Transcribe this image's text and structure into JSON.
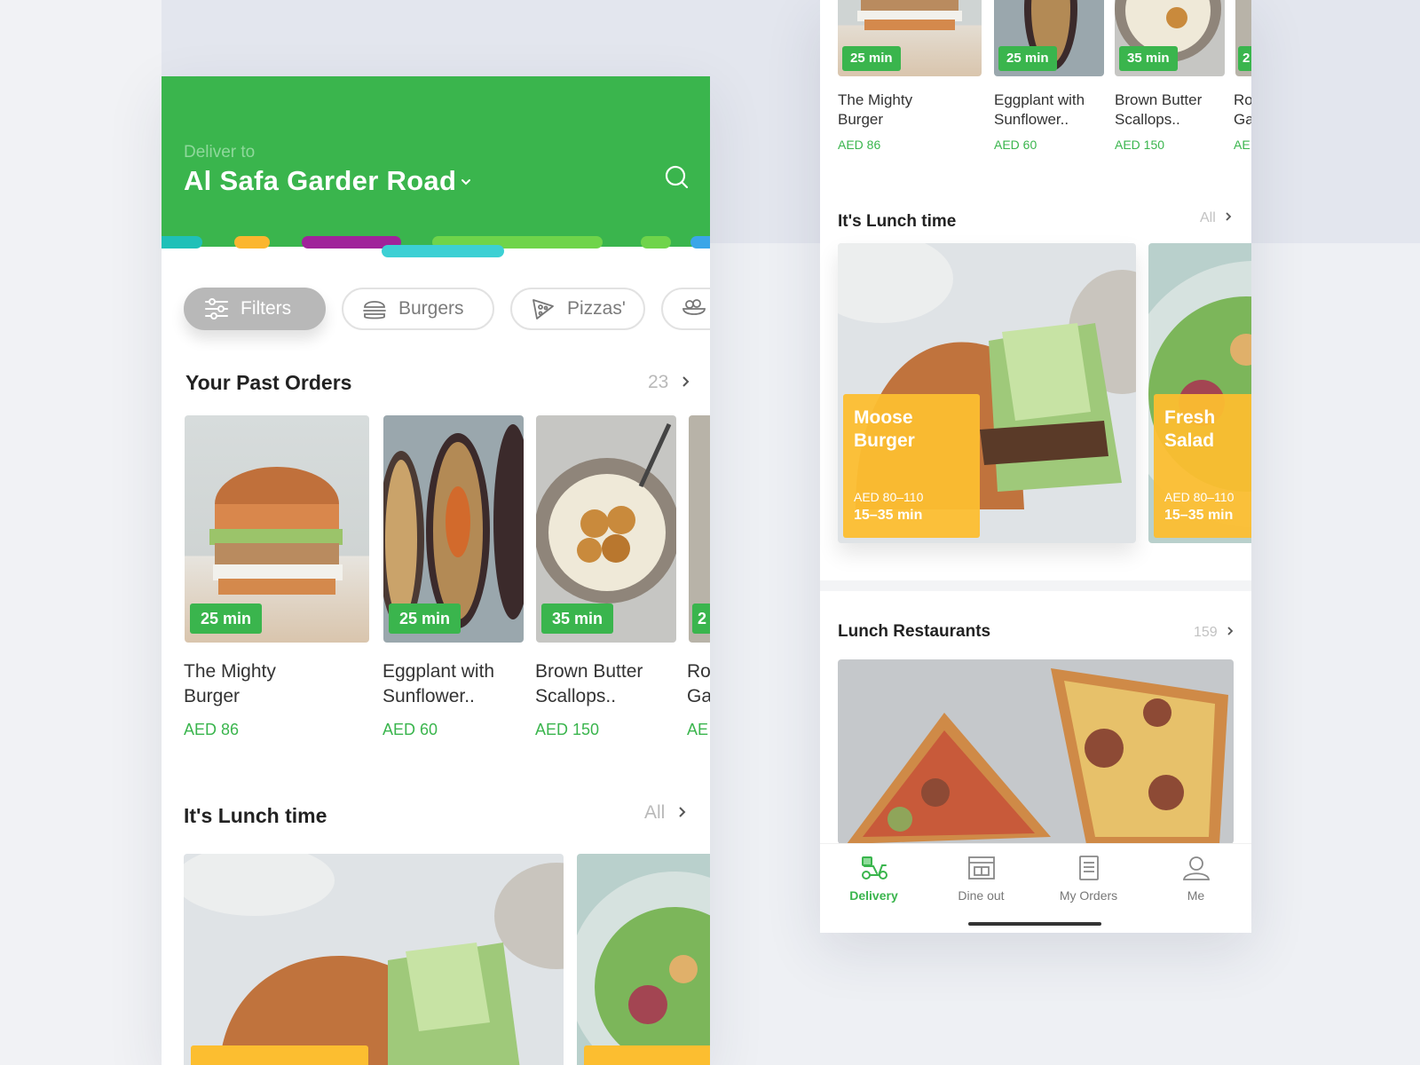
{
  "left": {
    "header": {
      "deliver_label": "Deliver to",
      "address": "Al Safa Garder Road"
    },
    "chips": [
      {
        "label": "Filters",
        "icon": "sliders-icon"
      },
      {
        "label": "Burgers",
        "icon": "burger-icon"
      },
      {
        "label": "Pizzas'",
        "icon": "pizza-icon"
      },
      {
        "label": "",
        "icon": "salad-bowl-icon"
      }
    ],
    "past_orders": {
      "title": "Your Past Orders",
      "count": "23",
      "items": [
        {
          "time": "25 min",
          "name_line1": "The Mighty",
          "name_line2": "Burger",
          "price": "AED 86"
        },
        {
          "time": "25 min",
          "name_line1": "Eggplant with",
          "name_line2": "Sunflower..",
          "price": "AED 60"
        },
        {
          "time": "35 min",
          "name_line1": "Brown Butter",
          "name_line2": "Scallops..",
          "price": "AED 150"
        },
        {
          "time": "2",
          "name_line1": "Ro",
          "name_line2": "Ga",
          "price": "AE"
        }
      ]
    },
    "lunch": {
      "title": "It's Lunch time",
      "all_label": "All"
    }
  },
  "right": {
    "past_orders": {
      "items": [
        {
          "time": "25 min",
          "name_line1": "The Mighty",
          "name_line2": "Burger",
          "price": "AED 86"
        },
        {
          "time": "25 min",
          "name_line1": "Eggplant with",
          "name_line2": "Sunflower..",
          "price": "AED 60"
        },
        {
          "time": "35 min",
          "name_line1": "Brown Butter",
          "name_line2": "Scallops..",
          "price": "AED 150"
        },
        {
          "time": "2",
          "name_line1": "Ro",
          "name_line2": "Ga",
          "price": "AE"
        }
      ]
    },
    "lunch": {
      "title": "It's Lunch time",
      "all_label": "All",
      "cards": [
        {
          "name_line1": "Moose",
          "name_line2": "Burger",
          "price": "AED 80–110",
          "time": "15–35 min"
        },
        {
          "name_line1": "Fresh",
          "name_line2": "Salad",
          "price": "AED 80–110",
          "time": "15–35 min"
        }
      ]
    },
    "restaurants": {
      "title": "Lunch Restaurants",
      "count": "159"
    },
    "tabs": [
      {
        "label": "Delivery",
        "icon": "delivery-scooter-icon",
        "active": true
      },
      {
        "label": "Dine out",
        "icon": "storefront-icon",
        "active": false
      },
      {
        "label": "My Orders",
        "icon": "receipt-list-icon",
        "active": false
      },
      {
        "label": "Me",
        "icon": "user-icon",
        "active": false
      }
    ]
  },
  "colors": {
    "brand_green": "#3ab54d",
    "accent_yellow": "#fcbe30",
    "stripe_teal": "#1fc0b8",
    "stripe_orange": "#fbb62f",
    "stripe_purple": "#a0239a",
    "stripe_cyan": "#3cd0d4",
    "stripe_lime": "#6fd44a",
    "stripe_blue": "#3aa6e8"
  }
}
